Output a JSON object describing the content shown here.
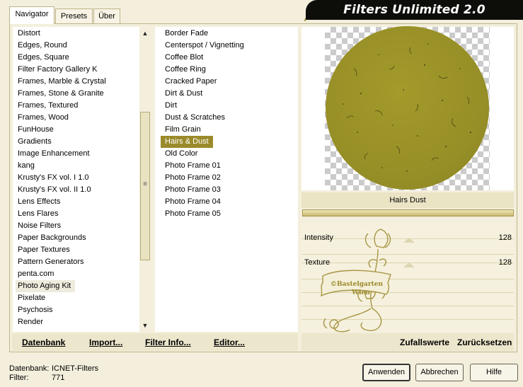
{
  "title": "Filters Unlimited 2.0",
  "tabs": [
    "Navigator",
    "Presets",
    "Über"
  ],
  "categories": {
    "items": [
      "Distort",
      "Edges, Round",
      "Edges, Square",
      "Filter Factory Gallery K",
      "Frames, Marble & Crystal",
      "Frames, Stone & Granite",
      "Frames, Textured",
      "Frames, Wood",
      "FunHouse",
      "Gradients",
      "Image Enhancement",
      "kang",
      "Krusty's FX vol. I 1.0",
      "Krusty's FX vol. II 1.0",
      "Lens Effects",
      "Lens Flares",
      "Noise Filters",
      "Paper Backgrounds",
      "Paper Textures",
      "Pattern Generators",
      "penta.com",
      "Photo Aging Kit",
      "Pixelate",
      "Psychosis",
      "Render"
    ],
    "selected": "Photo Aging Kit"
  },
  "filters": {
    "items": [
      "Border Fade",
      "Centerspot / Vignetting",
      "Coffee Blot",
      "Coffee Ring",
      "Cracked Paper",
      "Dirt & Dust",
      "Dirt",
      "Dust & Scratches",
      "Film Grain",
      "Hairs & Dust",
      "Old Color",
      "Photo Frame 01",
      "Photo Frame 02",
      "Photo Frame 03",
      "Photo Frame 04",
      "Photo Frame 05"
    ],
    "selected": "Hairs & Dust"
  },
  "preview": {
    "filter_label": "Hairs  Dust",
    "circle_color": "#978f27"
  },
  "params": [
    {
      "label": "Intensity",
      "value": "128",
      "level": 0.5
    },
    {
      "label": "Texture",
      "value": "128",
      "level": 0.5
    }
  ],
  "watermark": {
    "line1": "©Bastelgarten",
    "line2": "Wien"
  },
  "toolbar": {
    "datenbank": "Datenbank",
    "import": "Import...",
    "filter_info": "Filter Info...",
    "editor": "Editor...",
    "zufallswerte": "Zufallswerte",
    "zuruecksetzen": "Zurücksetzen"
  },
  "footer": {
    "db_label": "Datenbank:",
    "db_value": "ICNET-Filters",
    "filter_label": "Filter:",
    "filter_value": "771"
  },
  "buttons": {
    "apply": "Anwenden",
    "cancel": "Abbrechen",
    "help": "Hilfe"
  },
  "colors": {
    "accent_gold": "#9b8a2b",
    "background": "#f3efdc",
    "title_bg": "#0d0d0a"
  }
}
